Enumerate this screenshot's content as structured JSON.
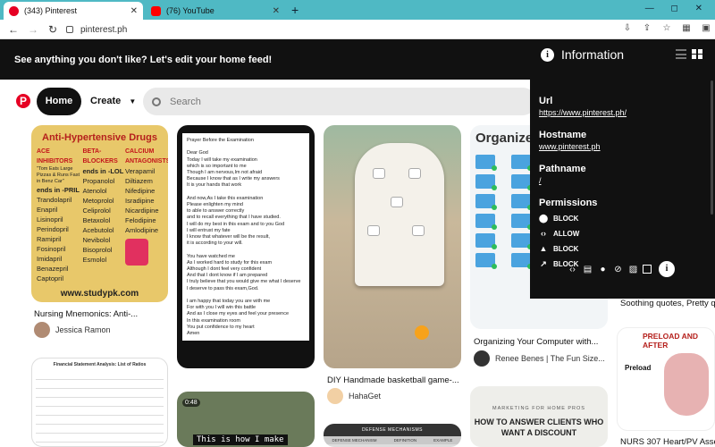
{
  "browser": {
    "tabs": [
      {
        "title": "(343) Pinterest",
        "favicon_color": "#e60023"
      },
      {
        "title": "(76) YouTube",
        "favicon_color": "#ff0000"
      }
    ],
    "new_tab_icon": "plus-icon",
    "window_controls": "—  ◻  ✕",
    "url": "pinterest.ph"
  },
  "banner": {
    "text": "See anything you don't like? Let's edit your home feed!"
  },
  "header": {
    "logo": "P",
    "home_label": "Home",
    "create_label": "Create",
    "search_placeholder": "Search"
  },
  "pins": {
    "drug": {
      "title": "Anti-Hypertensive Drugs",
      "col1_head": "ACE INHIBITORS",
      "col1_sub": "\"Tom Eats Large Pizzas & Runs Fast in Benz Car\"",
      "col1_tag": "ends in -PRIL",
      "col1": [
        "Trandolapril",
        "Enapril",
        "Lisinopril",
        "Perindopril",
        "Ramipril",
        "Fosinopril",
        "Imidapril",
        "Benazepril",
        "Captopril"
      ],
      "col2_head": "BETA-BLOCKERS",
      "col2_tag": "ends in -LOL",
      "col2": [
        "Propanolol",
        "Atenolol",
        "Metoprolol",
        "Celiprolol",
        "Betaxolol",
        "Acebutolol",
        "Nevibolol",
        "Bisoprolol",
        "Esmolol"
      ],
      "col3_head": "CALCIUM ANTAGONISTS",
      "col3": [
        "Verapamil",
        "Diltiazem",
        "Nifedipine",
        "Isradipine",
        "Nicardipine",
        "Felodipine",
        "Amlodipine"
      ],
      "footer": "www.studypk.com",
      "caption": "Nursing Mnemonics: Anti-...",
      "author": "Jessica Ramon"
    },
    "prayer": {
      "text": "Prayer Before the Examination\n\nDear God\nToday I will take my examination\nwhich is so important to me\nThough I am nervous,Im not afraid\nBecause I know that as I write my answers\nIt is your hands that work\n\nAnd now,As I take this examination\nPlease enlighten my mind\nto able to answer correctly\nand to recall everything that I have studied.\nI will do my best in this exam and to you God\nI will entrust my fate\nI know that whatever will be the result,\nit is according to your will.\n\nYou have watched me\nAs I worked hard to study for this exam\nAlthough I dont feel very confident\nAnd that I dont know if I am prepared\nI truly believe that you would give me what I deserve\nI deserve to pass this exam,God.\n\nI am happy that today you are with me\nFor with you I will win this battle\nAnd as I close my eyes and feel your presence\nIn this examination room\nYou put confidence to my heart\nAmen"
    },
    "bball": {
      "caption": "DIY Handmade basketball game-...",
      "author": "HahaGet"
    },
    "folders": {
      "heading": "Organize Your C",
      "caption": "Organizing Your Computer with...",
      "author": "Renee Benes | The Fun Size..."
    },
    "soothing": {
      "caption": "Soothing quotes, Pretty q"
    },
    "fin": {
      "title": "Financial Statement Analysis: List of Ratios"
    },
    "video": {
      "duration": "0:48",
      "subtitle": "This is how I make"
    },
    "defense": {
      "title": "DEFENSE MECHANISMS",
      "cols": [
        "DEFENSE MECHANISM",
        "DEFINITION",
        "EXAMPLE"
      ]
    },
    "homepros": {
      "kicker": "MARKETING FOR HOME PROS",
      "headline": "HOW TO ANSWER CLIENTS WHO WANT A DISCOUNT"
    },
    "preload": {
      "title": "PRELOAD AND AFTER",
      "label": "Preload",
      "caption": "NURS 307 Heart/PV Asse"
    }
  },
  "info_panel": {
    "title": "Information",
    "url_label": "Url",
    "url_value": "https://www.pinterest.ph/",
    "hostname_label": "Hostname",
    "hostname_value": "www.pinterest.ph",
    "pathname_label": "Pathname",
    "pathname_value": "/",
    "permissions_label": "Permissions",
    "permissions": [
      {
        "icon": "location-icon",
        "glyph": "⬤",
        "status": "BLOCK"
      },
      {
        "icon": "code-icon",
        "glyph": "‹›",
        "status": "ALLOW"
      },
      {
        "icon": "bell-icon",
        "glyph": "▲",
        "status": "BLOCK"
      },
      {
        "icon": "popup-icon",
        "glyph": "↗",
        "status": "BLOCK"
      }
    ],
    "info_glyph": "i"
  }
}
